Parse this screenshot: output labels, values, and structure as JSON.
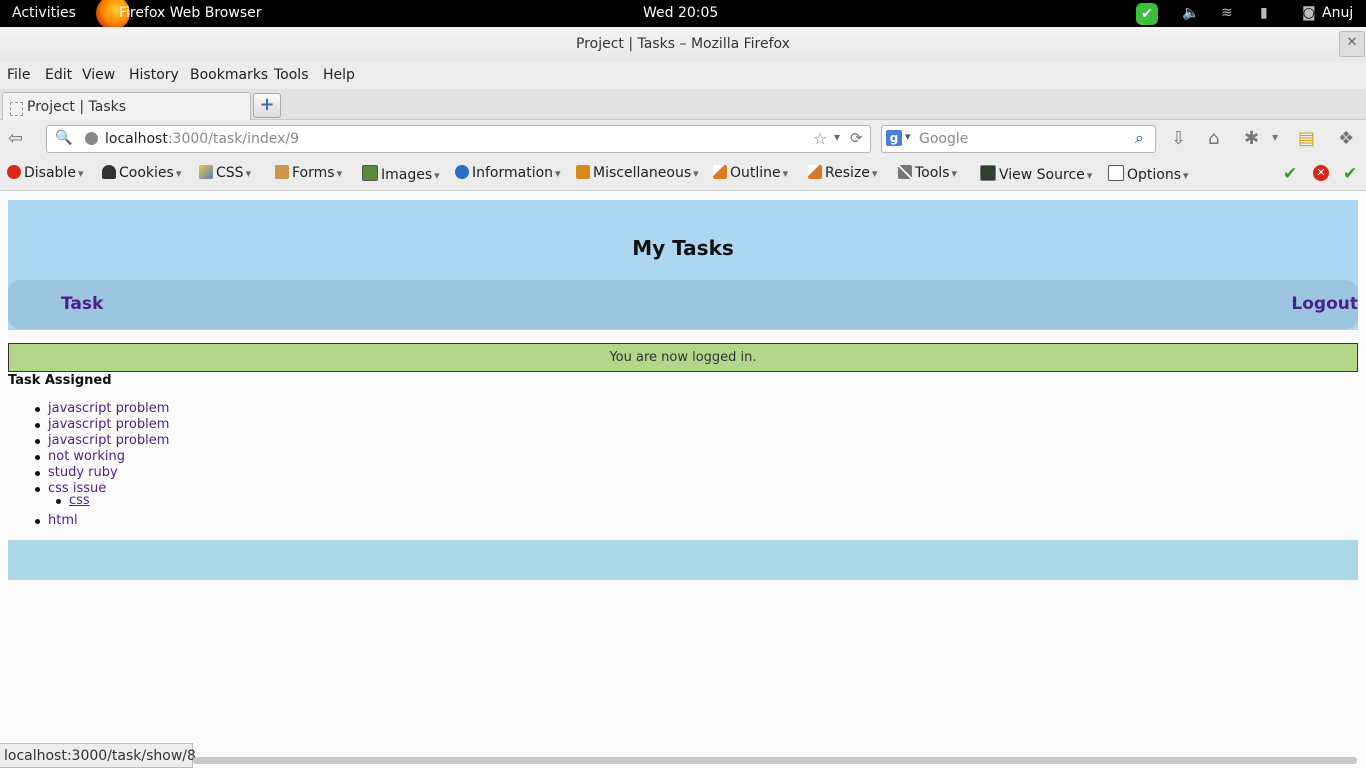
{
  "topbar": {
    "activities": "Activities",
    "app": "Firefox Web Browser",
    "clock": "Wed 20:05",
    "user": "Anuj"
  },
  "window": {
    "title": "Project | Tasks – Mozilla Firefox"
  },
  "menu": [
    "File",
    "Edit",
    "View",
    "History",
    "Bookmarks",
    "Tools",
    "Help"
  ],
  "tab": {
    "title": "Project | Tasks"
  },
  "url": {
    "host": "localhost",
    "path": ":3000/task/index/9"
  },
  "search": {
    "placeholder": "Google"
  },
  "devbar": [
    "Disable",
    "Cookies",
    "CSS",
    "Forms",
    "Images",
    "Information",
    "Miscellaneous",
    "Outline",
    "Resize",
    "Tools",
    "View Source",
    "Options"
  ],
  "page": {
    "heading": "My Tasks",
    "nav_task": "Task",
    "nav_logout": "Logout",
    "flash": "You are now logged in.",
    "assigned_heading": "Task Assigned",
    "tasks": [
      "javascript problem",
      "javascript problem",
      "javascript problem",
      "not working",
      "study ruby",
      "css issue",
      "html"
    ],
    "subtask": "css"
  },
  "status": "localhost:3000/task/show/8",
  "colors": {
    "header": "#acd6f1",
    "nav": "#9cc6e0",
    "flash": "#b2d68a",
    "footer": "#acd7e6",
    "link": "#4b1f8c"
  }
}
